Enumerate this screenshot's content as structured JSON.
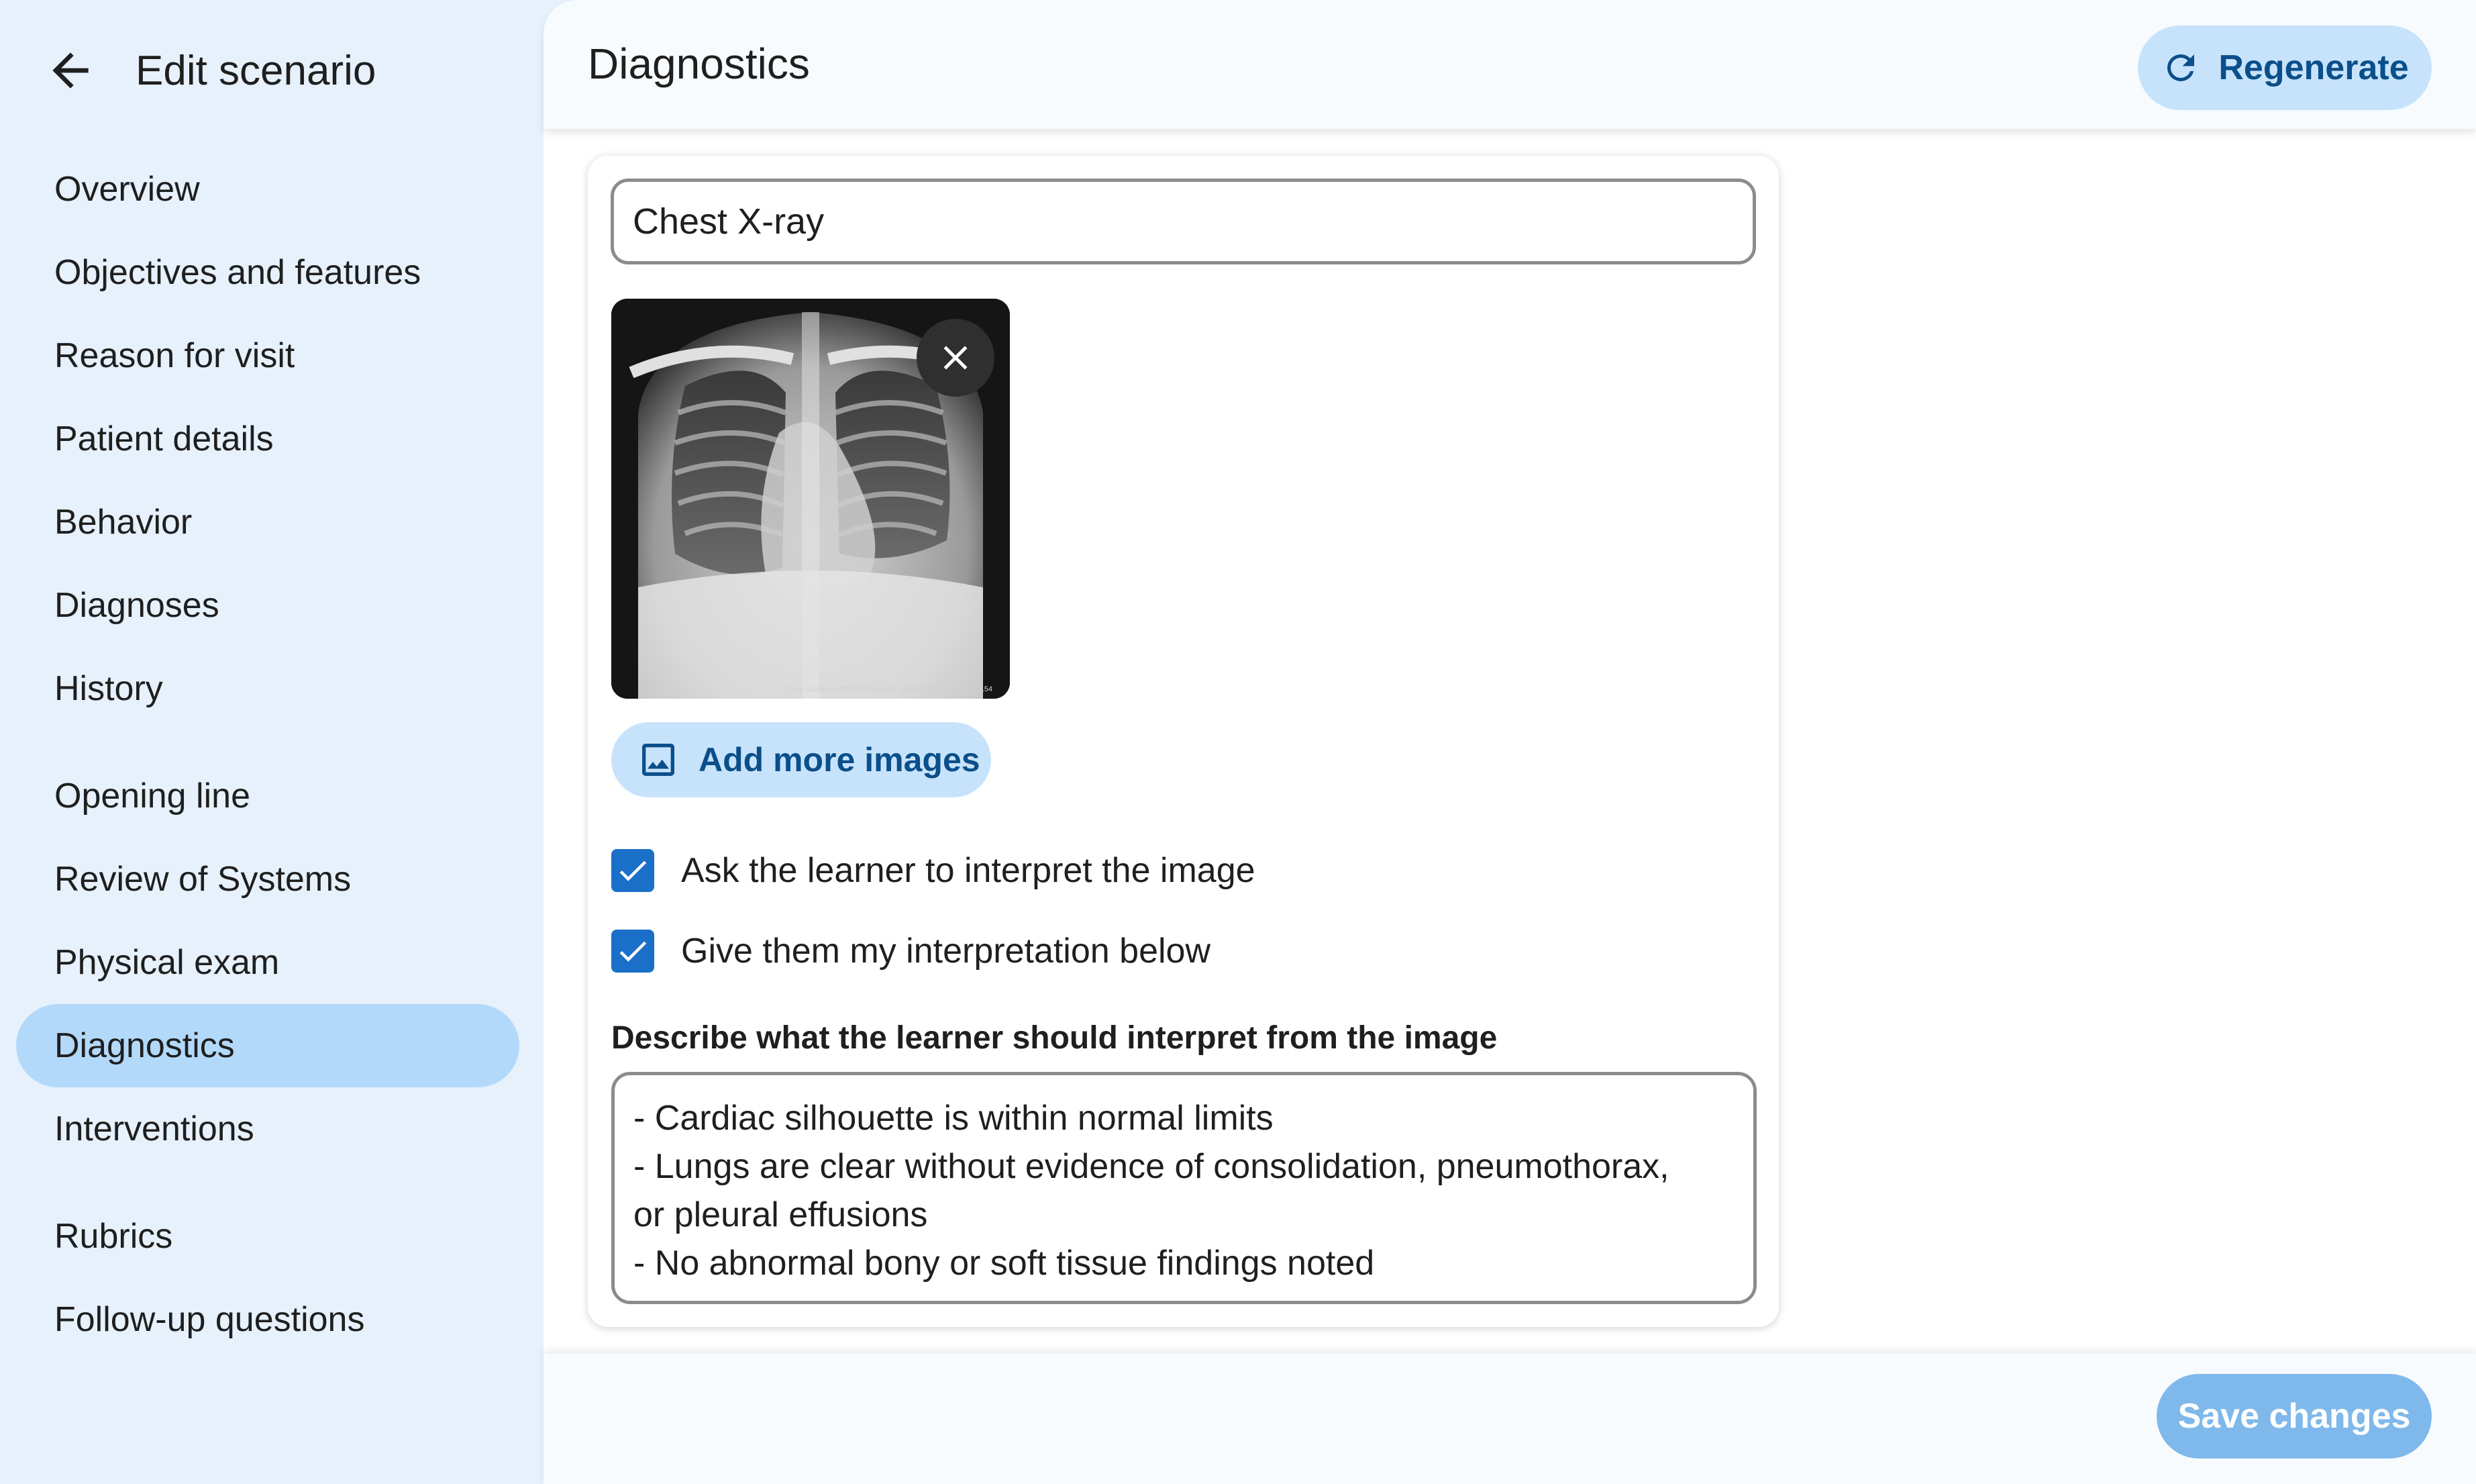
{
  "sidebar": {
    "title": "Edit scenario",
    "items": [
      {
        "label": "Overview"
      },
      {
        "label": "Objectives and features"
      },
      {
        "label": "Reason for visit"
      },
      {
        "label": "Patient details"
      },
      {
        "label": "Behavior"
      },
      {
        "label": "Diagnoses"
      },
      {
        "label": "History"
      },
      {
        "label": "Opening line"
      },
      {
        "label": "Review of Systems"
      },
      {
        "label": "Physical exam"
      },
      {
        "label": "Diagnostics"
      },
      {
        "label": "Interventions"
      },
      {
        "label": "Rubrics"
      },
      {
        "label": "Follow-up questions"
      }
    ],
    "active": "Diagnostics"
  },
  "header": {
    "title": "Diagnostics",
    "regenerate_label": "Regenerate"
  },
  "card": {
    "test_name": "Chest X-ray",
    "image_credit": "Case courtesy of Kristen Askaner, Radiopaedia.org, rID: 50154",
    "add_images_label": "Add more images",
    "checkbox_interpret": {
      "label": "Ask the learner to interpret the image",
      "checked": true
    },
    "checkbox_give": {
      "label": "Give them my interpretation below",
      "checked": true
    },
    "desc_label": "Describe what the learner should interpret from the image",
    "desc_lines": [
      "- Cardiac silhouette is within normal limits",
      "- Lungs are clear without evidence of consolidation, pneumothorax,",
      "or pleural effusions",
      "- No abnormal bony or soft tissue findings noted"
    ]
  },
  "footer": {
    "save_label": "Save changes"
  },
  "colors": {
    "sidebar_bg": "#e6f1fb",
    "active_bg": "#b3d9fa",
    "accent": "#1a6fc9",
    "button_bg": "#c7e3fb",
    "button_text": "#0b4f8a",
    "save_disabled": "#7fb8ea"
  }
}
